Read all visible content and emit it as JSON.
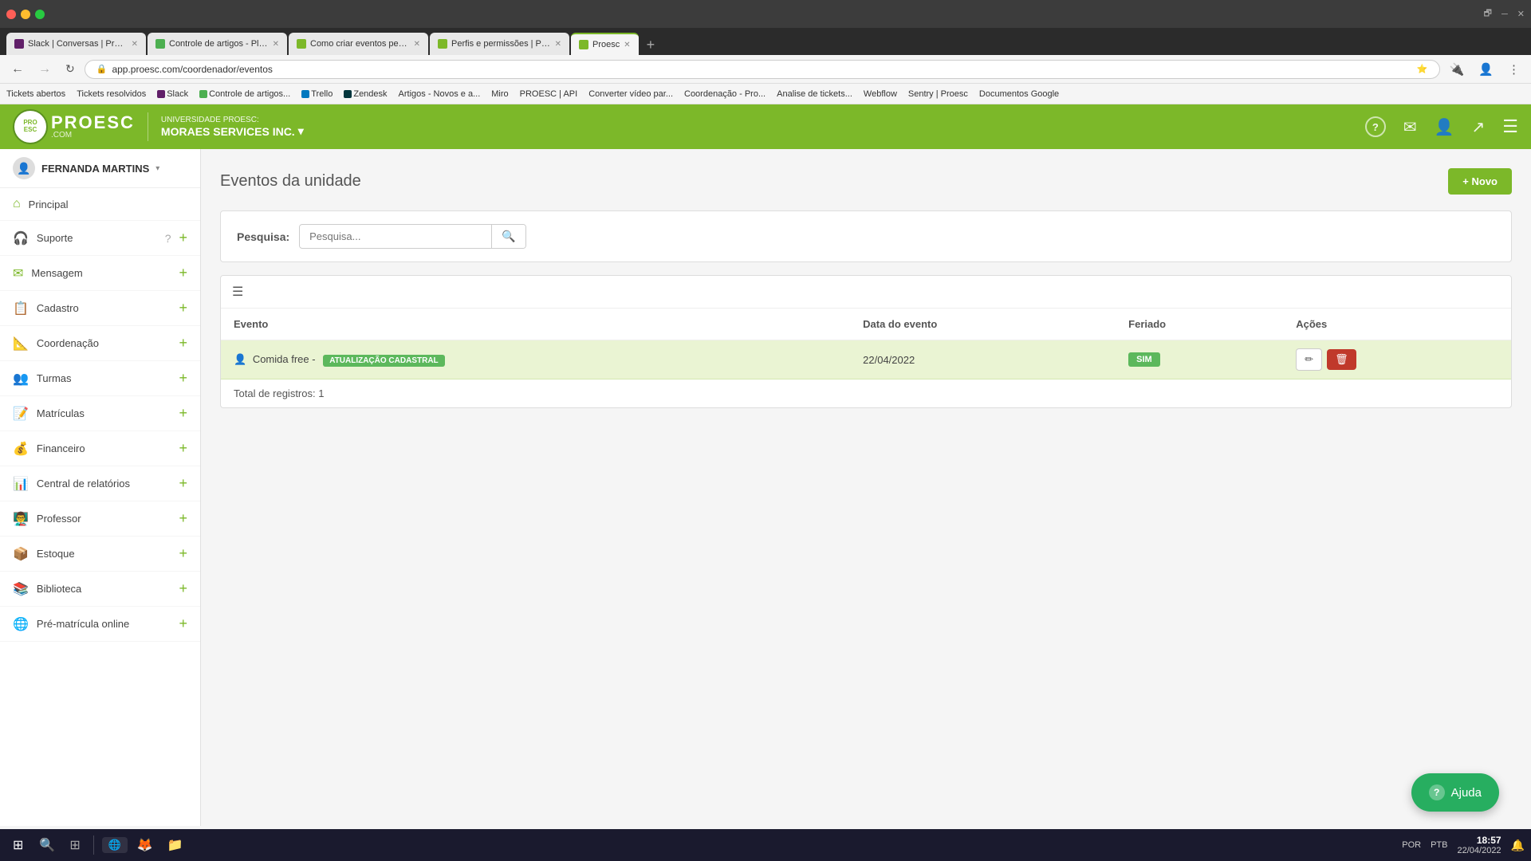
{
  "browser": {
    "tabs": [
      {
        "id": "tab1",
        "favicon_color": "#611f69",
        "label": "Slack | Conversas | Proesc.com",
        "active": false
      },
      {
        "id": "tab2",
        "favicon_color": "#4caf50",
        "label": "Controle de artigos - Planilhas G...",
        "active": false
      },
      {
        "id": "tab3",
        "favicon_color": "#7cb829",
        "label": "Como criar eventos pedagógico...",
        "active": false
      },
      {
        "id": "tab4",
        "favicon_color": "#7cb829",
        "label": "Perfis e permissões | PROESC - ...",
        "active": false
      },
      {
        "id": "tab5",
        "favicon_color": "#7cb829",
        "label": "Proesc",
        "active": true
      }
    ],
    "address": "app.proesc.com/coordenador/eventos",
    "new_tab_icon": "+"
  },
  "bookmarks": [
    "Tickets abertos",
    "Tickets resolvidos",
    "Slack",
    "Controle de artigos...",
    "Trello",
    "Zendesk",
    "Artigos - Novos e a...",
    "Miro",
    "PROESC | API",
    "Converter vídeo par...",
    "Coordenação - Pro...",
    "Analise de tickets...",
    "Webflow",
    "Sentry | Proesc",
    "Documentos Google"
  ],
  "header": {
    "university_label": "UNIVERSIDADE PROESC:",
    "unit_name": "MORAES SERVICES INC.",
    "unit_chevron": "▾",
    "icons": [
      "?",
      "✉",
      "👤",
      "↗",
      "☰"
    ]
  },
  "sidebar": {
    "user_name": "FERNANDA MARTINS",
    "user_chevron": "▾",
    "items": [
      {
        "id": "principal",
        "label": "Principal",
        "icon": "⌂",
        "has_plus": false
      },
      {
        "id": "suporte",
        "label": "Suporte",
        "icon": "🎧",
        "has_plus": true,
        "has_help": true
      },
      {
        "id": "mensagem",
        "label": "Mensagem",
        "icon": "✉",
        "has_plus": true
      },
      {
        "id": "cadastro",
        "label": "Cadastro",
        "icon": "📋",
        "has_plus": true
      },
      {
        "id": "coordenacao",
        "label": "Coordenação",
        "icon": "📐",
        "has_plus": true
      },
      {
        "id": "turmas",
        "label": "Turmas",
        "icon": "👥",
        "has_plus": true
      },
      {
        "id": "matriculas",
        "label": "Matrículas",
        "icon": "📝",
        "has_plus": true
      },
      {
        "id": "financeiro",
        "label": "Financeiro",
        "icon": "💰",
        "has_plus": true
      },
      {
        "id": "central-relatorios",
        "label": "Central de relatórios",
        "icon": "📊",
        "has_plus": true
      },
      {
        "id": "professor",
        "label": "Professor",
        "icon": "👨‍🏫",
        "has_plus": true
      },
      {
        "id": "estoque",
        "label": "Estoque",
        "icon": "📦",
        "has_plus": true
      },
      {
        "id": "biblioteca",
        "label": "Biblioteca",
        "icon": "📚",
        "has_plus": true
      },
      {
        "id": "pre-matricula",
        "label": "Pré-matrícula online",
        "icon": "🌐",
        "has_plus": true
      }
    ]
  },
  "page": {
    "title": "Eventos da unidade",
    "new_button": "+ Novo",
    "search_label": "Pesquisa:",
    "search_placeholder": "Pesquisa...",
    "table": {
      "columns": [
        "Evento",
        "Data do evento",
        "Feriado",
        "Ações"
      ],
      "rows": [
        {
          "event_name": "Comida free -",
          "badge_label": "ATUALIZAÇÃO CADASTRAL",
          "date": "22/04/2022",
          "holiday": "SIM"
        }
      ],
      "total_text": "Total de registros:  1"
    }
  },
  "help_button": "Ajuda",
  "taskbar": {
    "time": "18:57",
    "date": "22/04/2022",
    "language": "POR",
    "battery": "PTB"
  }
}
